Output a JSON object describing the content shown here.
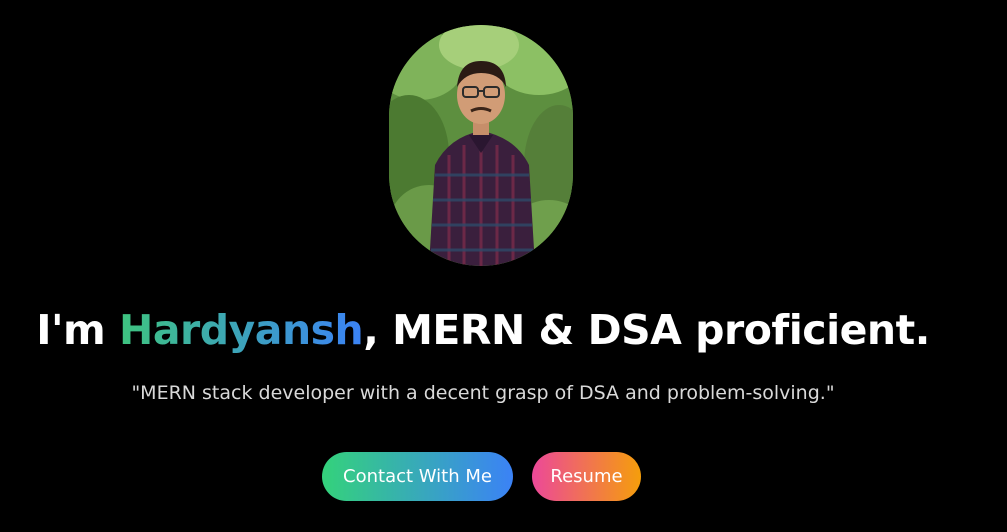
{
  "profile": {
    "photo_alt": "Profile photo",
    "headline_prefix": "I'm ",
    "name": "Hardyansh",
    "headline_suffix": ", MERN & DSA proficient.",
    "tagline": "\"MERN stack developer with a decent grasp of DSA and problem-solving.\""
  },
  "actions": {
    "contact_label": "Contact With Me",
    "resume_label": "Resume"
  },
  "colors": {
    "background": "#000000",
    "name_gradient_start": "#3ec47f",
    "name_gradient_end": "#3b82f6",
    "contact_gradient_start": "#34d27b",
    "contact_gradient_end": "#3b82f6",
    "resume_gradient_start": "#ec4899",
    "resume_gradient_end": "#f59e0b"
  }
}
